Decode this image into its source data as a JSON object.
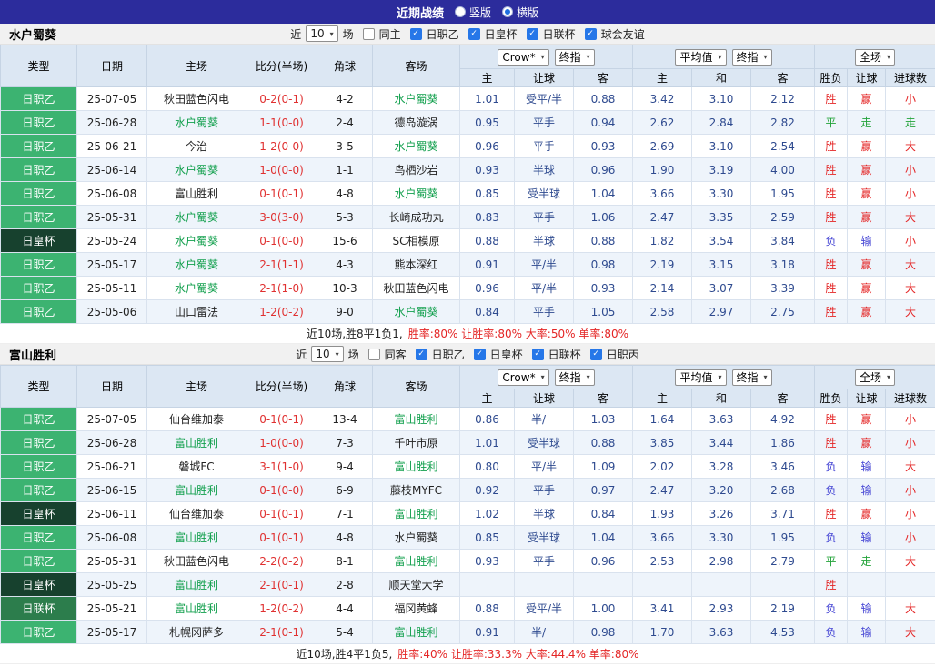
{
  "topbar": {
    "title": "近期战绩",
    "radios": [
      {
        "label": "竖版",
        "selected": false
      },
      {
        "label": "横版",
        "selected": true
      }
    ]
  },
  "sections": [
    {
      "team": "水户蜀葵",
      "filter": {
        "near": "近",
        "count": "10",
        "games": "场",
        "same": {
          "label": "同主",
          "checked": false
        },
        "leagues": [
          {
            "label": "日职乙",
            "checked": true
          },
          {
            "label": "日皇杯",
            "checked": true
          },
          {
            "label": "日联杯",
            "checked": true
          },
          {
            "label": "球会友谊",
            "checked": true
          }
        ]
      },
      "columns": {
        "type": "类型",
        "date": "日期",
        "home": "主场",
        "score": "比分(半场)",
        "corner": "角球",
        "away": "客场",
        "sub": [
          "主",
          "让球",
          "客",
          "主",
          "和",
          "客",
          "胜负",
          "让球",
          "进球数"
        ]
      },
      "dropdowns": {
        "company": "Crow*",
        "final1": "终指",
        "avg": "平均值",
        "final2": "终指",
        "full": "全场"
      },
      "rows": [
        {
          "type": "日职乙",
          "tc": "t-l2",
          "date": "25-07-05",
          "home": "秋田蓝色闪电",
          "hf": false,
          "score": "0-2(0-1)",
          "corner": "4-2",
          "away": "水户蜀葵",
          "af": true,
          "odds": [
            "1.01",
            "受平/半",
            "0.88",
            "3.42",
            "3.10",
            "2.12"
          ],
          "res": [
            [
              "胜",
              "rr"
            ],
            [
              "赢",
              "rr"
            ],
            [
              "小",
              "rr"
            ]
          ]
        },
        {
          "type": "日职乙",
          "tc": "t-l2",
          "date": "25-06-28",
          "home": "水户蜀葵",
          "hf": true,
          "score": "1-1(0-0)",
          "corner": "2-4",
          "away": "德岛漩涡",
          "af": false,
          "odds": [
            "0.95",
            "平手",
            "0.94",
            "2.62",
            "2.84",
            "2.82"
          ],
          "res": [
            [
              "平",
              "rg"
            ],
            [
              "走",
              "rg"
            ],
            [
              "走",
              "rg"
            ]
          ]
        },
        {
          "type": "日职乙",
          "tc": "t-l2",
          "date": "25-06-21",
          "home": "今治",
          "hf": false,
          "score": "1-2(0-0)",
          "corner": "3-5",
          "away": "水户蜀葵",
          "af": true,
          "odds": [
            "0.96",
            "平手",
            "0.93",
            "2.69",
            "3.10",
            "2.54"
          ],
          "res": [
            [
              "胜",
              "rr"
            ],
            [
              "赢",
              "rr"
            ],
            [
              "大",
              "rr"
            ]
          ]
        },
        {
          "type": "日职乙",
          "tc": "t-l2",
          "date": "25-06-14",
          "home": "水户蜀葵",
          "hf": true,
          "score": "1-0(0-0)",
          "corner": "1-1",
          "away": "鸟栖沙岩",
          "af": false,
          "odds": [
            "0.93",
            "半球",
            "0.96",
            "1.90",
            "3.19",
            "4.00"
          ],
          "res": [
            [
              "胜",
              "rr"
            ],
            [
              "赢",
              "rr"
            ],
            [
              "小",
              "rr"
            ]
          ]
        },
        {
          "type": "日职乙",
          "tc": "t-l2",
          "date": "25-06-08",
          "home": "富山胜利",
          "hf": false,
          "score": "0-1(0-1)",
          "corner": "4-8",
          "away": "水户蜀葵",
          "af": true,
          "odds": [
            "0.85",
            "受半球",
            "1.04",
            "3.66",
            "3.30",
            "1.95"
          ],
          "res": [
            [
              "胜",
              "rr"
            ],
            [
              "赢",
              "rr"
            ],
            [
              "小",
              "rr"
            ]
          ]
        },
        {
          "type": "日职乙",
          "tc": "t-l2",
          "date": "25-05-31",
          "home": "水户蜀葵",
          "hf": true,
          "score": "3-0(3-0)",
          "corner": "5-3",
          "away": "长崎成功丸",
          "af": false,
          "odds": [
            "0.83",
            "平手",
            "1.06",
            "2.47",
            "3.35",
            "2.59"
          ],
          "res": [
            [
              "胜",
              "rr"
            ],
            [
              "赢",
              "rr"
            ],
            [
              "大",
              "rr"
            ]
          ]
        },
        {
          "type": "日皇杯",
          "tc": "t-cup",
          "date": "25-05-24",
          "home": "水户蜀葵",
          "hf": true,
          "score": "0-1(0-0)",
          "corner": "15-6",
          "away": "SC相模原",
          "af": false,
          "odds": [
            "0.88",
            "半球",
            "0.88",
            "1.82",
            "3.54",
            "3.84"
          ],
          "res": [
            [
              "负",
              "rb"
            ],
            [
              "输",
              "rb"
            ],
            [
              "小",
              "rr"
            ]
          ]
        },
        {
          "type": "日职乙",
          "tc": "t-l2",
          "date": "25-05-17",
          "home": "水户蜀葵",
          "hf": true,
          "score": "2-1(1-1)",
          "corner": "4-3",
          "away": "熊本深红",
          "af": false,
          "odds": [
            "0.91",
            "平/半",
            "0.98",
            "2.19",
            "3.15",
            "3.18"
          ],
          "res": [
            [
              "胜",
              "rr"
            ],
            [
              "赢",
              "rr"
            ],
            [
              "大",
              "rr"
            ]
          ]
        },
        {
          "type": "日职乙",
          "tc": "t-l2",
          "date": "25-05-11",
          "home": "水户蜀葵",
          "hf": true,
          "score": "2-1(1-0)",
          "corner": "10-3",
          "away": "秋田蓝色闪电",
          "af": false,
          "odds": [
            "0.96",
            "平/半",
            "0.93",
            "2.14",
            "3.07",
            "3.39"
          ],
          "res": [
            [
              "胜",
              "rr"
            ],
            [
              "赢",
              "rr"
            ],
            [
              "大",
              "rr"
            ]
          ]
        },
        {
          "type": "日职乙",
          "tc": "t-l2",
          "date": "25-05-06",
          "home": "山口雷法",
          "hf": false,
          "score": "1-2(0-2)",
          "corner": "9-0",
          "away": "水户蜀葵",
          "af": true,
          "odds": [
            "0.84",
            "平手",
            "1.05",
            "2.58",
            "2.97",
            "2.75"
          ],
          "res": [
            [
              "胜",
              "rr"
            ],
            [
              "赢",
              "rr"
            ],
            [
              "大",
              "rr"
            ]
          ]
        }
      ],
      "summary": {
        "prefix": "近10场,胜8平1负1,",
        "stats": "胜率:80% 让胜率:80% 大率:50% 单率:80%"
      }
    },
    {
      "team": "富山胜利",
      "filter": {
        "near": "近",
        "count": "10",
        "games": "场",
        "same": {
          "label": "同客",
          "checked": false
        },
        "leagues": [
          {
            "label": "日职乙",
            "checked": true
          },
          {
            "label": "日皇杯",
            "checked": true
          },
          {
            "label": "日联杯",
            "checked": true
          },
          {
            "label": "日职丙",
            "checked": true
          }
        ]
      },
      "columns": {
        "type": "类型",
        "date": "日期",
        "home": "主场",
        "score": "比分(半场)",
        "corner": "角球",
        "away": "客场",
        "sub": [
          "主",
          "让球",
          "客",
          "主",
          "和",
          "客",
          "胜负",
          "让球",
          "进球数"
        ]
      },
      "dropdowns": {
        "company": "Crow*",
        "final1": "终指",
        "avg": "平均值",
        "final2": "终指",
        "full": "全场"
      },
      "rows": [
        {
          "type": "日职乙",
          "tc": "t-l2",
          "date": "25-07-05",
          "home": "仙台维加泰",
          "hf": false,
          "score": "0-1(0-1)",
          "corner": "13-4",
          "away": "富山胜利",
          "af": true,
          "odds": [
            "0.86",
            "半/一",
            "1.03",
            "1.64",
            "3.63",
            "4.92"
          ],
          "res": [
            [
              "胜",
              "rr"
            ],
            [
              "赢",
              "rr"
            ],
            [
              "小",
              "rr"
            ]
          ]
        },
        {
          "type": "日职乙",
          "tc": "t-l2",
          "date": "25-06-28",
          "home": "富山胜利",
          "hf": true,
          "score": "1-0(0-0)",
          "corner": "7-3",
          "away": "千叶市原",
          "af": false,
          "odds": [
            "1.01",
            "受半球",
            "0.88",
            "3.85",
            "3.44",
            "1.86"
          ],
          "res": [
            [
              "胜",
              "rr"
            ],
            [
              "赢",
              "rr"
            ],
            [
              "小",
              "rr"
            ]
          ]
        },
        {
          "type": "日职乙",
          "tc": "t-l2",
          "date": "25-06-21",
          "home": "磐城FC",
          "hf": false,
          "score": "3-1(1-0)",
          "corner": "9-4",
          "away": "富山胜利",
          "af": true,
          "odds": [
            "0.80",
            "平/半",
            "1.09",
            "2.02",
            "3.28",
            "3.46"
          ],
          "res": [
            [
              "负",
              "rb"
            ],
            [
              "输",
              "rb"
            ],
            [
              "大",
              "rr"
            ]
          ]
        },
        {
          "type": "日职乙",
          "tc": "t-l2",
          "date": "25-06-15",
          "home": "富山胜利",
          "hf": true,
          "score": "0-1(0-0)",
          "corner": "6-9",
          "away": "藤枝MYFC",
          "af": false,
          "odds": [
            "0.92",
            "平手",
            "0.97",
            "2.47",
            "3.20",
            "2.68"
          ],
          "res": [
            [
              "负",
              "rb"
            ],
            [
              "输",
              "rb"
            ],
            [
              "小",
              "rr"
            ]
          ]
        },
        {
          "type": "日皇杯",
          "tc": "t-cup",
          "date": "25-06-11",
          "home": "仙台维加泰",
          "hf": false,
          "score": "0-1(0-1)",
          "corner": "7-1",
          "away": "富山胜利",
          "af": true,
          "odds": [
            "1.02",
            "半球",
            "0.84",
            "1.93",
            "3.26",
            "3.71"
          ],
          "res": [
            [
              "胜",
              "rr"
            ],
            [
              "赢",
              "rr"
            ],
            [
              "小",
              "rr"
            ]
          ]
        },
        {
          "type": "日职乙",
          "tc": "t-l2",
          "date": "25-06-08",
          "home": "富山胜利",
          "hf": true,
          "score": "0-1(0-1)",
          "corner": "4-8",
          "away": "水户蜀葵",
          "af": false,
          "odds": [
            "0.85",
            "受半球",
            "1.04",
            "3.66",
            "3.30",
            "1.95"
          ],
          "res": [
            [
              "负",
              "rb"
            ],
            [
              "输",
              "rb"
            ],
            [
              "小",
              "rr"
            ]
          ]
        },
        {
          "type": "日职乙",
          "tc": "t-l2",
          "date": "25-05-31",
          "home": "秋田蓝色闪电",
          "hf": false,
          "score": "2-2(0-2)",
          "corner": "8-1",
          "away": "富山胜利",
          "af": true,
          "odds": [
            "0.93",
            "平手",
            "0.96",
            "2.53",
            "2.98",
            "2.79"
          ],
          "res": [
            [
              "平",
              "rg"
            ],
            [
              "走",
              "rg"
            ],
            [
              "大",
              "rr"
            ]
          ]
        },
        {
          "type": "日皇杯",
          "tc": "t-cup",
          "date": "25-05-25",
          "home": "富山胜利",
          "hf": true,
          "score": "2-1(0-1)",
          "corner": "2-8",
          "away": "顺天堂大学",
          "af": false,
          "odds": [
            "",
            "",
            "",
            "",
            "",
            ""
          ],
          "res": [
            [
              "胜",
              "rr"
            ],
            [
              "",
              ""
            ],
            [
              "",
              ""
            ]
          ]
        },
        {
          "type": "日联杯",
          "tc": "t-lc",
          "date": "25-05-21",
          "home": "富山胜利",
          "hf": true,
          "score": "1-2(0-2)",
          "corner": "4-4",
          "away": "福冈黄蜂",
          "af": false,
          "odds": [
            "0.88",
            "受平/半",
            "1.00",
            "3.41",
            "2.93",
            "2.19"
          ],
          "res": [
            [
              "负",
              "rb"
            ],
            [
              "输",
              "rb"
            ],
            [
              "大",
              "rr"
            ]
          ]
        },
        {
          "type": "日职乙",
          "tc": "t-l2",
          "date": "25-05-17",
          "home": "札幌冈萨多",
          "hf": false,
          "score": "2-1(0-1)",
          "corner": "5-4",
          "away": "富山胜利",
          "af": true,
          "odds": [
            "0.91",
            "半/一",
            "0.98",
            "1.70",
            "3.63",
            "4.53"
          ],
          "res": [
            [
              "负",
              "rb"
            ],
            [
              "输",
              "rb"
            ],
            [
              "大",
              "rr"
            ]
          ]
        }
      ],
      "summary": {
        "prefix": "近10场,胜4平1负5,",
        "stats": "胜率:40% 让胜率:33.3% 大率:44.4% 单率:80%"
      }
    }
  ]
}
